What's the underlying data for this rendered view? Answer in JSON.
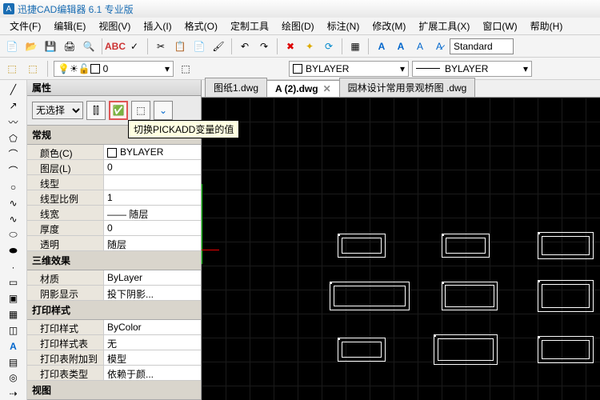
{
  "title": "迅捷CAD编辑器 6.1 专业版",
  "menu": [
    "文件(F)",
    "编辑(E)",
    "视图(V)",
    "插入(I)",
    "格式(O)",
    "定制工具",
    "绘图(D)",
    "标注(N)",
    "修改(M)",
    "扩展工具(X)",
    "窗口(W)",
    "帮助(H)"
  ],
  "style_combo": "Standard",
  "layer_value": "0",
  "bylayer1": "BYLAYER",
  "bylayer2": "BYLAYER",
  "tabs": [
    {
      "label": "图纸1.dwg",
      "active": false
    },
    {
      "label": "A (2).dwg",
      "active": true
    },
    {
      "label": "园林设计常用景观桥图 .dwg",
      "active": false
    }
  ],
  "tooltip": "切换PICKADD变量的值",
  "prop": {
    "header": "属性",
    "filter_sel": "无选择",
    "groups": {
      "g1": "常规",
      "g2": "三维效果",
      "g3": "打印样式",
      "g4": "视图"
    },
    "rows": {
      "color_l": "颜色(C)",
      "color_v": "BYLAYER",
      "layer_l": "图层(L)",
      "layer_v": "0",
      "ltype_l": "线型",
      "ltype_v": "",
      "lscale_l": "线型比例",
      "lscale_v": "1",
      "lweight_l": "线宽",
      "lweight_v": "—— 随层",
      "thick_l": "厚度",
      "thick_v": "0",
      "trans_l": "透明",
      "trans_v": "随层",
      "mat_l": "材质",
      "mat_v": "ByLayer",
      "shadow_l": "阴影显示",
      "shadow_v": "投下阴影...",
      "pstyle_l": "打印样式",
      "pstyle_v": "ByColor",
      "ptable_l": "打印样式表",
      "ptable_v": "无",
      "pattach_l": "打印表附加到",
      "pattach_v": "模型",
      "ptype_l": "打印表类型",
      "ptype_v": "依赖于颜..."
    }
  }
}
